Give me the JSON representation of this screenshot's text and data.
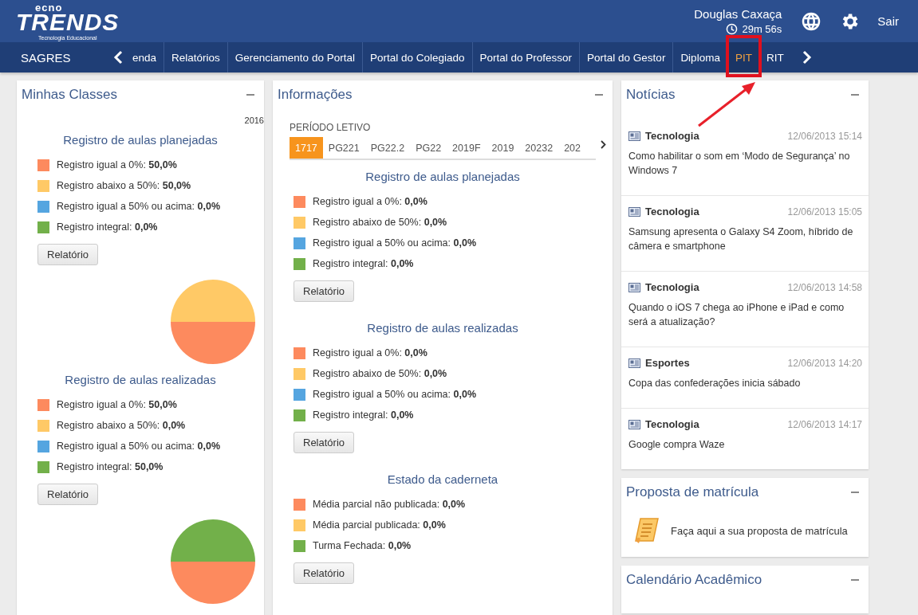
{
  "header": {
    "logo": {
      "top": "ecno",
      "main": "TRENDS",
      "tagline": "Tecnologia Educacional"
    },
    "user": "Douglas Caxaça",
    "session_time": "29m 56s",
    "logout": "Sair"
  },
  "nav": {
    "system": "SAGRES",
    "items": [
      {
        "label": "enda",
        "selected": false
      },
      {
        "label": "Relatórios",
        "selected": false
      },
      {
        "label": "Gerenciamento do Portal",
        "selected": false
      },
      {
        "label": "Portal do Colegiado",
        "selected": false
      },
      {
        "label": "Portal do Professor",
        "selected": false
      },
      {
        "label": "Portal do Gestor",
        "selected": false
      },
      {
        "label": "Diploma",
        "selected": false
      },
      {
        "label": "PIT",
        "selected": true
      },
      {
        "label": "RIT",
        "selected": false
      }
    ]
  },
  "classes": {
    "title": "Minhas Classes",
    "year": "2016",
    "sections": [
      {
        "title": "Registro de aulas planejadas",
        "legend": [
          {
            "label": "Registro igual a 0%:",
            "value": "50,0%",
            "color": "#fd8a5e"
          },
          {
            "label": "Registro abaixo a 50%:",
            "value": "50,0%",
            "color": "#ffc966"
          },
          {
            "label": "Registro igual a 50% ou acima:",
            "value": "0,0%",
            "color": "#55a5e0"
          },
          {
            "label": "Registro integral:",
            "value": "0,0%",
            "color": "#72b04a"
          }
        ],
        "button": "Relatório",
        "chart_data": {
          "type": "pie",
          "values": [
            50,
            50,
            0,
            0
          ]
        }
      },
      {
        "title": "Registro de aulas realizadas",
        "legend": [
          {
            "label": "Registro igual a 0%:",
            "value": "50,0%",
            "color": "#fd8a5e"
          },
          {
            "label": "Registro abaixo a 50%:",
            "value": "0,0%",
            "color": "#ffc966"
          },
          {
            "label": "Registro igual a 50% ou acima:",
            "value": "0,0%",
            "color": "#55a5e0"
          },
          {
            "label": "Registro integral:",
            "value": "50,0%",
            "color": "#72b04a"
          }
        ],
        "button": "Relatório",
        "chart_data": {
          "type": "pie",
          "values": [
            50,
            0,
            0,
            50
          ]
        }
      }
    ]
  },
  "info": {
    "title": "Informações",
    "period_label": "PERÍODO LETIVO",
    "periods": [
      {
        "label": "1717",
        "selected": true
      },
      {
        "label": "PG221",
        "selected": false
      },
      {
        "label": "PG22.2",
        "selected": false
      },
      {
        "label": "PG22",
        "selected": false
      },
      {
        "label": "2019F",
        "selected": false
      },
      {
        "label": "2019",
        "selected": false
      },
      {
        "label": "20232",
        "selected": false
      },
      {
        "label": "202",
        "selected": false
      }
    ],
    "sections": [
      {
        "title": "Registro de aulas planejadas",
        "legend": [
          {
            "label": "Registro igual a 0%:",
            "value": "0,0%",
            "color": "#fd8a5e"
          },
          {
            "label": "Registro abaixo de 50%:",
            "value": "0,0%",
            "color": "#ffc966"
          },
          {
            "label": "Registro igual a 50% ou acima:",
            "value": "0,0%",
            "color": "#55a5e0"
          },
          {
            "label": "Registro integral:",
            "value": "0,0%",
            "color": "#72b04a"
          }
        ],
        "button": "Relatório"
      },
      {
        "title": "Registro de aulas realizadas",
        "legend": [
          {
            "label": "Registro igual a 0%:",
            "value": "0,0%",
            "color": "#fd8a5e"
          },
          {
            "label": "Registro abaixo de 50%:",
            "value": "0,0%",
            "color": "#ffc966"
          },
          {
            "label": "Registro igual a 50% ou acima:",
            "value": "0,0%",
            "color": "#55a5e0"
          },
          {
            "label": "Registro integral:",
            "value": "0,0%",
            "color": "#72b04a"
          }
        ],
        "button": "Relatório"
      },
      {
        "title": "Estado da caderneta",
        "legend": [
          {
            "label": "Média parcial não publicada:",
            "value": "0,0%",
            "color": "#fd8a5e"
          },
          {
            "label": "Média parcial publicada:",
            "value": "0,0%",
            "color": "#ffc966"
          },
          {
            "label": "Turma Fechada:",
            "value": "0,0%",
            "color": "#72b04a"
          }
        ],
        "button": "Relatório"
      }
    ]
  },
  "news": {
    "title": "Notícias",
    "items": [
      {
        "category": "Tecnologia",
        "date": "12/06/2013 15:14",
        "title": "Como habilitar o som em ‘Modo de Segurança’ no Windows 7"
      },
      {
        "category": "Tecnologia",
        "date": "12/06/2013 15:05",
        "title": "Samsung apresenta o Galaxy S4 Zoom, híbrido de câmera e smartphone"
      },
      {
        "category": "Tecnologia",
        "date": "12/06/2013 14:58",
        "title": "Quando o iOS 7 chega ao iPhone e iPad e como será a atualização?"
      },
      {
        "category": "Esportes",
        "date": "12/06/2013 14:20",
        "title": "Copa das confederações inicia sábado"
      },
      {
        "category": "Tecnologia",
        "date": "12/06/2013 14:17",
        "title": "Google compra Waze"
      }
    ]
  },
  "proposal": {
    "title": "Proposta de matrícula",
    "text": "Faça aqui a sua proposta de matrícula"
  },
  "calendar": {
    "title": "Calendário Acadêmico"
  }
}
